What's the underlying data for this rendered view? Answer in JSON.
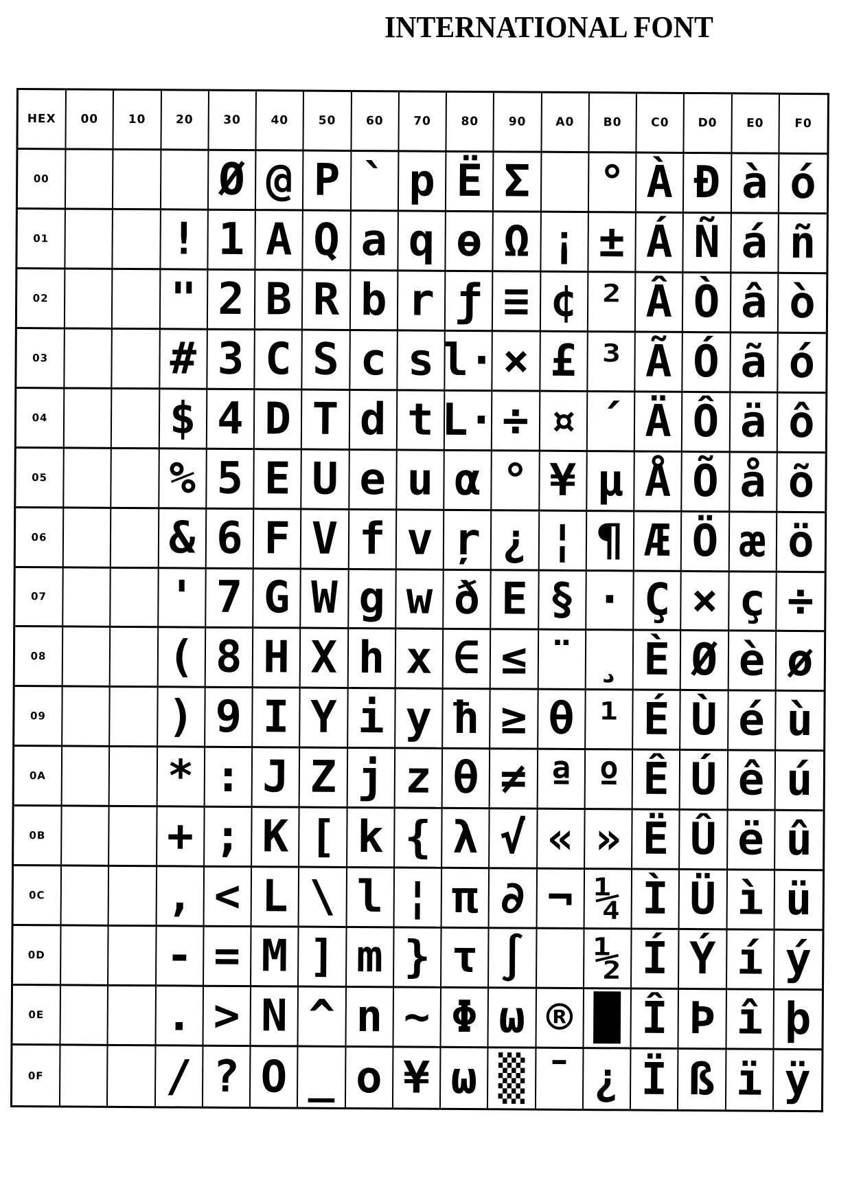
{
  "title": "INTERNATIONAL FONT",
  "table": {
    "corner_label": "HEX",
    "column_headers": [
      "00",
      "10",
      "20",
      "30",
      "40",
      "50",
      "60",
      "70",
      "80",
      "90",
      "A0",
      "B0",
      "C0",
      "D0",
      "E0",
      "F0"
    ],
    "rows": [
      {
        "label": "00",
        "cells": [
          "",
          "",
          "",
          "Ø",
          "@",
          "P",
          "`",
          "p",
          "Ë",
          "Σ",
          "",
          "°",
          "À",
          "Ð",
          "à",
          "ó"
        ]
      },
      {
        "label": "01",
        "cells": [
          "",
          "",
          "!",
          "1",
          "A",
          "Q",
          "a",
          "q",
          "ɵ",
          "Ω",
          "¡",
          "±",
          "Á",
          "Ñ",
          "á",
          "ñ"
        ]
      },
      {
        "label": "02",
        "cells": [
          "",
          "",
          "\"",
          "2",
          "B",
          "R",
          "b",
          "r",
          "ƒ",
          "≡",
          "¢",
          "²",
          "Â",
          "Ò",
          "â",
          "ò"
        ]
      },
      {
        "label": "03",
        "cells": [
          "",
          "",
          "#",
          "3",
          "C",
          "S",
          "c",
          "s",
          "l·",
          "×",
          "£",
          "³",
          "Ã",
          "Ó",
          "ã",
          "ó"
        ]
      },
      {
        "label": "04",
        "cells": [
          "",
          "",
          "$",
          "4",
          "D",
          "T",
          "d",
          "t",
          "L·",
          "÷",
          "¤",
          "´",
          "Ä",
          "Ô",
          "ä",
          "ô"
        ]
      },
      {
        "label": "05",
        "cells": [
          "",
          "",
          "%",
          "5",
          "E",
          "U",
          "e",
          "u",
          "α",
          "°",
          "¥",
          "µ",
          "Å",
          "Õ",
          "å",
          "õ"
        ]
      },
      {
        "label": "06",
        "cells": [
          "",
          "",
          "&",
          "6",
          "F",
          "V",
          "f",
          "v",
          "ŗ",
          "¿",
          "¦",
          "¶",
          "Æ",
          "Ö",
          "æ",
          "ö"
        ]
      },
      {
        "label": "07",
        "cells": [
          "",
          "",
          "'",
          "7",
          "G",
          "W",
          "g",
          "w",
          "ð",
          "E",
          "§",
          "·",
          "Ç",
          "×",
          "ç",
          "÷"
        ]
      },
      {
        "label": "08",
        "cells": [
          "",
          "",
          "(",
          "8",
          "H",
          "X",
          "h",
          "x",
          "∈",
          "≤",
          "¨",
          "¸",
          "È",
          "Ø",
          "è",
          "ø"
        ]
      },
      {
        "label": "09",
        "cells": [
          "",
          "",
          ")",
          "9",
          "I",
          "Y",
          "i",
          "y",
          "ħ",
          "≥",
          "θ",
          "¹",
          "É",
          "Ù",
          "é",
          "ù"
        ]
      },
      {
        "label": "0A",
        "cells": [
          "",
          "",
          "*",
          ":",
          "J",
          "Z",
          "j",
          "z",
          "θ",
          "≠",
          "ª",
          "º",
          "Ê",
          "Ú",
          "ê",
          "ú"
        ]
      },
      {
        "label": "0B",
        "cells": [
          "",
          "",
          "+",
          ";",
          "K",
          "[",
          "k",
          "{",
          "λ",
          "√",
          "«",
          "»",
          "Ë",
          "Û",
          "ë",
          "û"
        ]
      },
      {
        "label": "0C",
        "cells": [
          "",
          "",
          ",",
          "<",
          "L",
          "\\",
          "l",
          "¦",
          "π",
          "∂",
          "¬",
          "¼",
          "Ì",
          "Ü",
          "ì",
          "ü"
        ]
      },
      {
        "label": "0D",
        "cells": [
          "",
          "",
          "-",
          "=",
          "M",
          "]",
          "m",
          "}",
          "τ",
          "∫",
          "",
          "½",
          "Í",
          "Ý",
          "í",
          "ý"
        ]
      },
      {
        "label": "0E",
        "cells": [
          "",
          "",
          ".",
          ">",
          "N",
          "^",
          "n",
          "~",
          "Φ",
          "ω",
          "®",
          "█",
          "Î",
          "Þ",
          "î",
          "þ"
        ]
      },
      {
        "label": "0F",
        "cells": [
          "",
          "",
          "/",
          "?",
          "O",
          "_",
          "o",
          "¥",
          "ω",
          "▒",
          "¯",
          "¿",
          "Ï",
          "ß",
          "ï",
          "ÿ"
        ]
      }
    ]
  }
}
